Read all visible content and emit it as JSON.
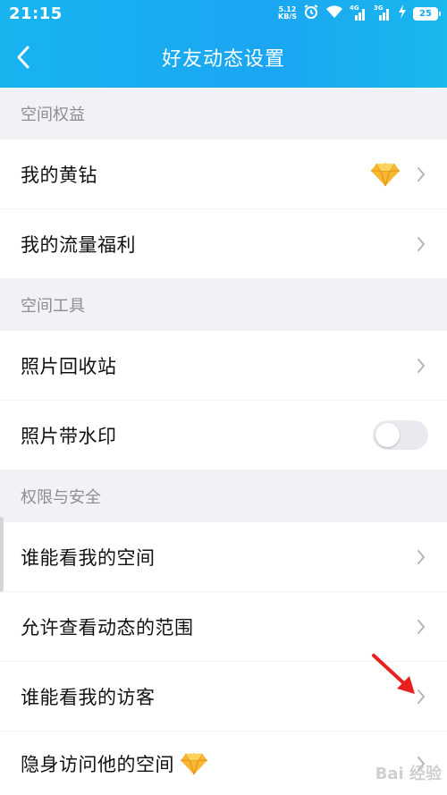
{
  "status_bar": {
    "time": "21:15",
    "net_speed_value": "5.12",
    "net_speed_unit": "KB/S",
    "signal1_type": "4G",
    "signal2_type": "3G",
    "battery": "25"
  },
  "header": {
    "title": "好友动态设置"
  },
  "sections": [
    {
      "title": "空间权益",
      "items": [
        {
          "label": "我的黄钻",
          "icon": "diamond-icon",
          "control": "chevron"
        },
        {
          "label": "我的流量福利",
          "control": "chevron"
        }
      ]
    },
    {
      "title": "空间工具",
      "items": [
        {
          "label": "照片回收站",
          "control": "chevron"
        },
        {
          "label": "照片带水印",
          "control": "toggle",
          "toggle_on": false
        }
      ]
    },
    {
      "title": "权限与安全",
      "items": [
        {
          "label": "谁能看我的空间",
          "control": "chevron"
        },
        {
          "label": "允许查看动态的范围",
          "control": "chevron"
        },
        {
          "label": "谁能看我的访客",
          "control": "chevron"
        },
        {
          "label": "隐身访问他的空间",
          "icon": "diamond-icon",
          "control": "chevron"
        }
      ]
    }
  ],
  "colors": {
    "header_gradient_start": "#18b4f0",
    "header_gradient_end": "#19b8ee",
    "annotation_arrow": "#e8201e",
    "diamond": "#f5a623"
  },
  "watermark": "Bai 经验"
}
